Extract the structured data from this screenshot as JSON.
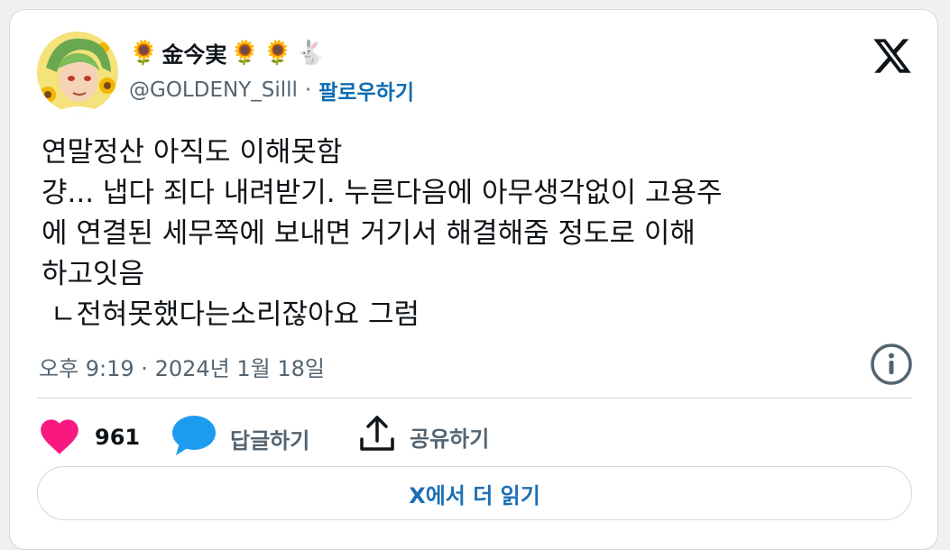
{
  "user": {
    "display_name": "金今実",
    "name_emojis_before": [
      "🌻"
    ],
    "name_emojis_after": [
      "🌻",
      "🌻",
      "🐇"
    ],
    "handle": "@GOLDENY_Silll",
    "separator": "·",
    "follow_label": "팔로우하기"
  },
  "tweet": {
    "lines": [
      "연말정산 아직도 이해못함",
      "걍... 냅다 죄다 내려받기. 누른다음에 아무생각없이 고용주",
      "에 연결된 세무쪽에 보내면 거기서 해결해줌 정도로 이해",
      "하고잇음",
      " ㄴ전혀못했다는소리잖아요 그럼"
    ],
    "timestamp": "오후 9:19 · 2024년 1월 18일"
  },
  "actions": {
    "like_count": "961",
    "reply_label": "답글하기",
    "share_label": "공유하기"
  },
  "read_more_label": "X에서 더 읽기",
  "colors": {
    "like": "#f91880",
    "reply": "#1d9bf0",
    "follow": "#0d6bb3",
    "muted": "#536471",
    "border": "#cfd9de"
  },
  "icons": [
    "x-logo-icon",
    "info-icon",
    "heart-icon",
    "reply-bubble-icon",
    "share-icon"
  ]
}
